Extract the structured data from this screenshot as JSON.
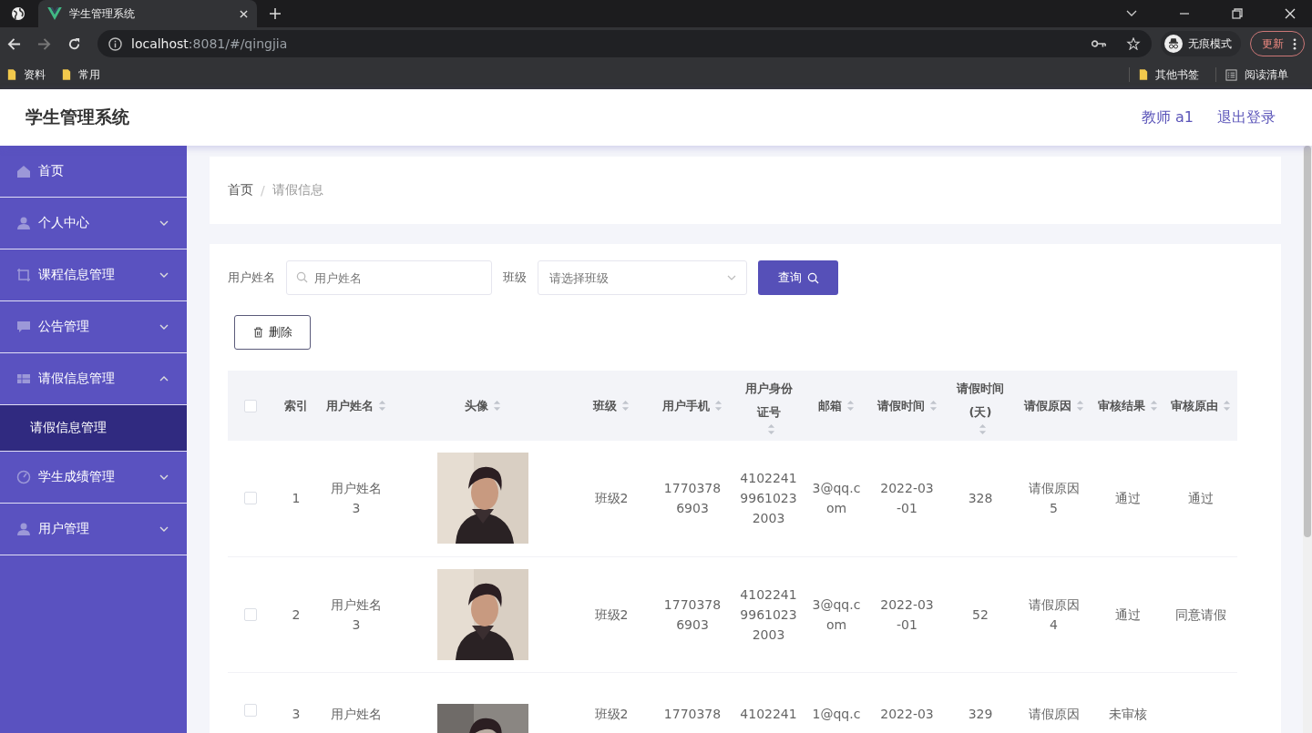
{
  "browser": {
    "tab_title": "学生管理系统",
    "url_host": "localhost",
    "url_rest": ":8081/#/qingjia",
    "profile": "无痕模式",
    "update": "更新",
    "bookmarks": [
      {
        "label": "资料"
      },
      {
        "label": "常用"
      }
    ],
    "bookmarks_right": [
      {
        "label": "其他书签",
        "kind": "folder"
      },
      {
        "label": "阅读清单",
        "kind": "list"
      }
    ]
  },
  "header": {
    "title": "学生管理系统",
    "user": "教师 a1",
    "logout": "退出登录"
  },
  "sidebar": {
    "items": [
      {
        "label": "首页",
        "kind": "link"
      },
      {
        "label": "个人中心",
        "kind": "menu",
        "expanded": false
      },
      {
        "label": "课程信息管理",
        "kind": "menu",
        "expanded": false
      },
      {
        "label": "公告管理",
        "kind": "menu",
        "expanded": false
      },
      {
        "label": "请假信息管理",
        "kind": "menu",
        "expanded": true,
        "children": [
          {
            "label": "请假信息管理",
            "selected": true
          }
        ]
      },
      {
        "label": "学生成绩管理",
        "kind": "menu",
        "expanded": false
      },
      {
        "label": "用户管理",
        "kind": "menu",
        "expanded": false
      }
    ]
  },
  "breadcrumb": {
    "items": [
      "首页",
      "请假信息"
    ],
    "separator": "/"
  },
  "search": {
    "name_label": "用户姓名",
    "name_placeholder": "用户姓名",
    "class_label": "班级",
    "class_placeholder": "请选择班级",
    "button": "查询"
  },
  "delete_button": "删除",
  "table": {
    "select_all": {
      "checked": false
    },
    "columns": [
      {
        "label": "索引",
        "sortable": false
      },
      {
        "label": "用户姓名",
        "sortable": true
      },
      {
        "label": "头像",
        "sortable": true
      },
      {
        "label": "班级",
        "sortable": true
      },
      {
        "label": "用户手机",
        "sortable": true
      },
      {
        "label": "用户身份证号",
        "sortable": true
      },
      {
        "label": "邮箱",
        "sortable": true
      },
      {
        "label": "请假时间",
        "sortable": true
      },
      {
        "label": "请假时间(天)",
        "sortable": true
      },
      {
        "label": "请假原因",
        "sortable": true
      },
      {
        "label": "审核结果",
        "sortable": true
      },
      {
        "label": "审核原由",
        "sortable": true
      }
    ],
    "rows": [
      {
        "checked": false,
        "cells": [
          "1",
          "用户姓名3",
          {
            "kind": "picture"
          },
          "班级2",
          "17703786903",
          "410224199610232003",
          "3@qq.com",
          "2022-03-01",
          "328",
          "请假原因5",
          "通过",
          "通过"
        ]
      },
      {
        "checked": false,
        "cells": [
          "2",
          "用户姓名3",
          {
            "kind": "picture"
          },
          "班级2",
          "17703786903",
          "410224199610232003",
          "3@qq.com",
          "2022-03-01",
          "52",
          "请假原因4",
          "通过",
          "同意请假"
        ]
      },
      {
        "checked": false,
        "cells": [
          "3",
          "用户姓名",
          {
            "kind": "picture"
          },
          "班级2",
          "1770378",
          "4102241",
          "1@qq.c",
          "2022-03",
          "329",
          "请假原因",
          "未审核",
          ""
        ]
      }
    ]
  }
}
